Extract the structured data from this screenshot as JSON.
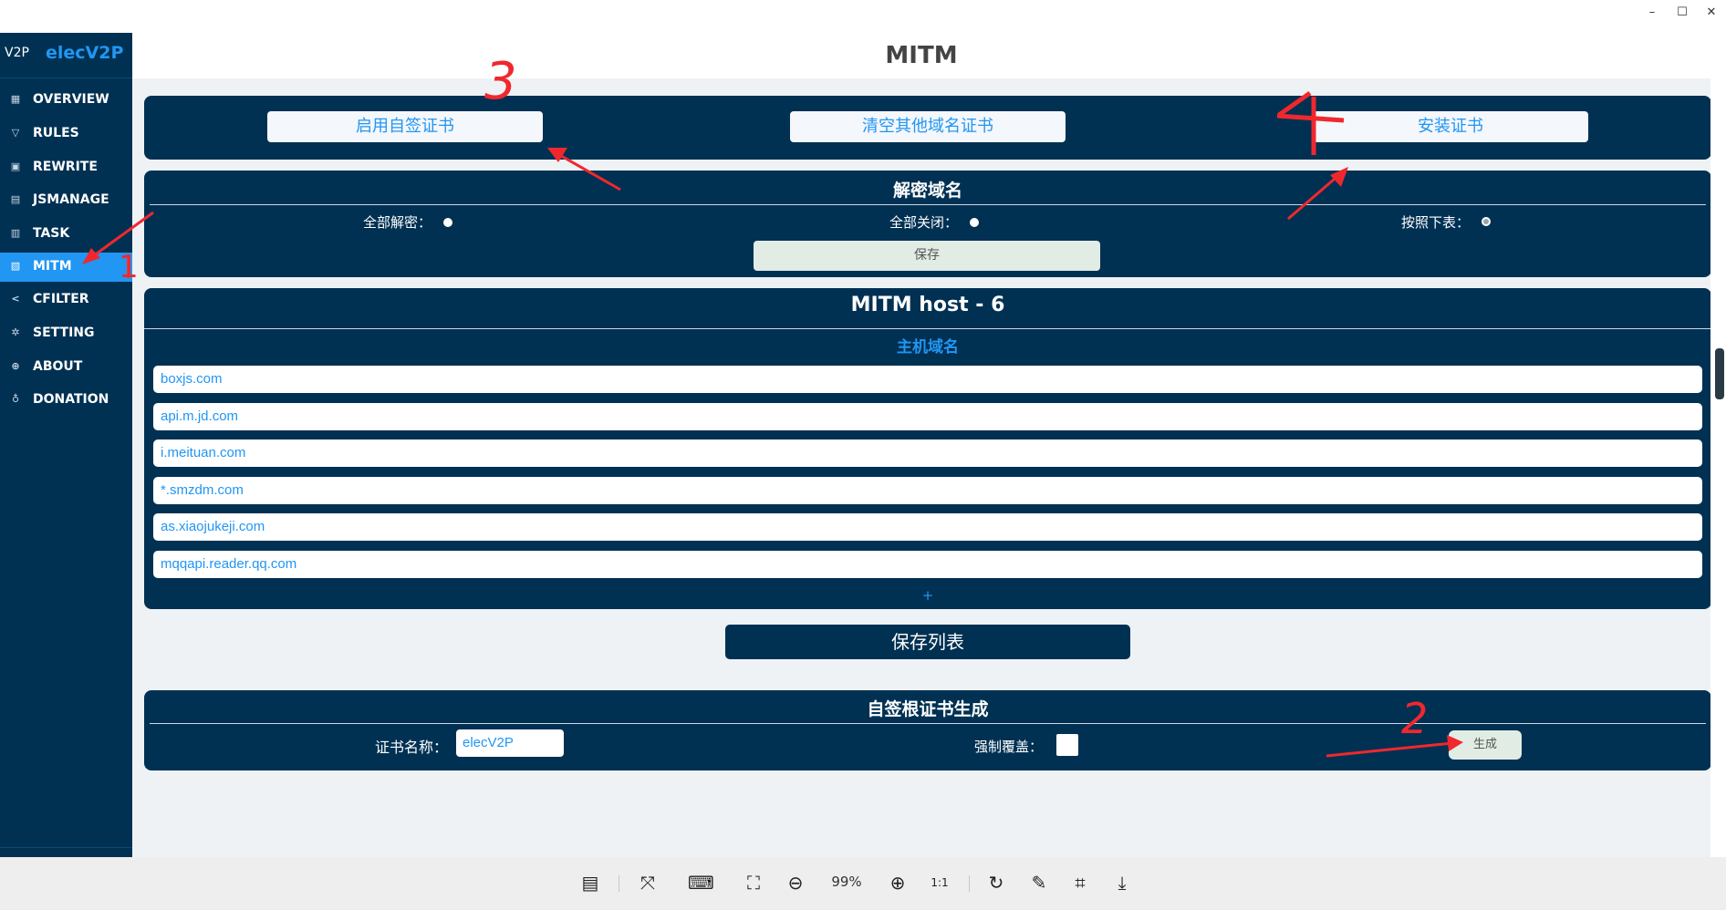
{
  "window": {
    "minimize": "–",
    "maximize": "☐",
    "close": "✕"
  },
  "sidebar": {
    "logo": "V2P",
    "app_name": "elecV2P",
    "items": [
      {
        "label": "OVERVIEW",
        "icon": "▦"
      },
      {
        "label": "RULES",
        "icon": "▽"
      },
      {
        "label": "REWRITE",
        "icon": "▣"
      },
      {
        "label": "JSMANAGE",
        "icon": "▤"
      },
      {
        "label": "TASK",
        "icon": "▥"
      },
      {
        "label": "MITM",
        "icon": "▧",
        "active": true
      },
      {
        "label": "CFILTER",
        "icon": "<"
      },
      {
        "label": "SETTING",
        "icon": "✲"
      },
      {
        "label": "ABOUT",
        "icon": "⊕"
      },
      {
        "label": "DONATION",
        "icon": "♁"
      }
    ]
  },
  "page": {
    "title": "MITM"
  },
  "cert_buttons": {
    "enable_self_signed": "启用自签证书",
    "clear_other": "清空其他域名证书",
    "install": "安装证书"
  },
  "decrypt": {
    "title": "解密域名",
    "options": [
      {
        "label": "全部解密：",
        "selected": false
      },
      {
        "label": "全部关闭：",
        "selected": false
      },
      {
        "label": "按照下表：",
        "selected": true
      }
    ],
    "save": "保存"
  },
  "hosts": {
    "title": "MITM host - 6",
    "column": "主机域名",
    "rows": [
      "boxjs.com",
      "api.m.jd.com",
      "i.meituan.com",
      "*.smzdm.com",
      "as.xiaojukeji.com",
      "mqqapi.reader.qq.com"
    ],
    "add": "+"
  },
  "save_list": "保存列表",
  "rootcert": {
    "title": "自签根证书生成",
    "name_label": "证书名称：",
    "name_value": "elecV2P",
    "force_label": "强制覆盖：",
    "generate": "生成"
  },
  "annotations": {
    "n1": "1",
    "n2": "2",
    "n3": "3",
    "n4": "4",
    "color": "#f0282d"
  },
  "viewer_toolbar": {
    "zoom": "99%",
    "one_to_one": "1:1"
  }
}
